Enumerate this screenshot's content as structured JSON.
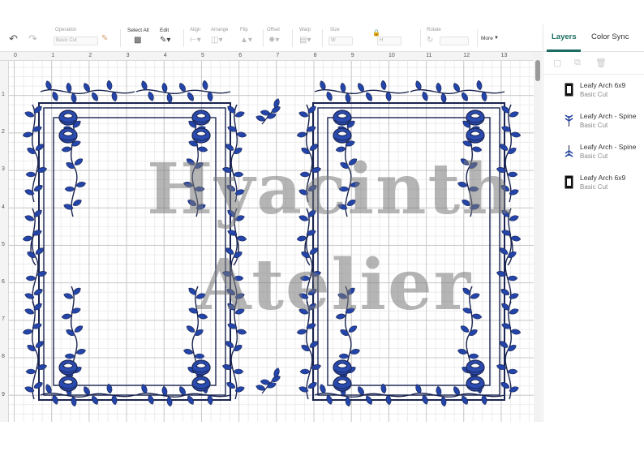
{
  "colors": {
    "accent": "#1b6d60",
    "design_blue": "#1f3fa0",
    "design_navy": "#1a2450"
  },
  "toolbar": {
    "undo_icon": "undo-icon",
    "redo_icon": "redo-icon",
    "operation": {
      "label": "Operation",
      "value": "Basic Cut"
    },
    "select_all": {
      "label": "Select All"
    },
    "edit": {
      "label": "Edit"
    },
    "align": {
      "label": "Align"
    },
    "arrange": {
      "label": "Arrange"
    },
    "flip": {
      "label": "Flip"
    },
    "offset": {
      "label": "Offset"
    },
    "warp": {
      "label": "Warp"
    },
    "size": {
      "label": "Size",
      "w_label": "W",
      "h_label": "H"
    },
    "rotate": {
      "label": "Rotate"
    },
    "more": {
      "label": "More"
    }
  },
  "ruler": {
    "top": [
      "0",
      "1",
      "2",
      "3",
      "4",
      "5",
      "6",
      "7",
      "8",
      "9",
      "10",
      "11",
      "12",
      "13"
    ],
    "left": [
      "1",
      "2",
      "3",
      "4",
      "5",
      "6",
      "7",
      "8",
      "9"
    ]
  },
  "panel": {
    "tabs": [
      {
        "label": "Layers",
        "active": true
      },
      {
        "label": "Color Sync",
        "active": false
      }
    ],
    "layers": [
      {
        "name": "Leafy Arch 6x9",
        "operation": "Basic Cut",
        "thumb": "frame"
      },
      {
        "name": "Leafy Arch - Spine",
        "operation": "Basic Cut",
        "thumb": "sprig"
      },
      {
        "name": "Leafy Arch - Spine",
        "operation": "Basic Cut",
        "thumb": "sprig"
      },
      {
        "name": "Leafy Arch 6x9",
        "operation": "Basic Cut",
        "thumb": "frame"
      }
    ]
  },
  "watermark": {
    "line1": "Hyacinth",
    "line2": "Atelier"
  }
}
